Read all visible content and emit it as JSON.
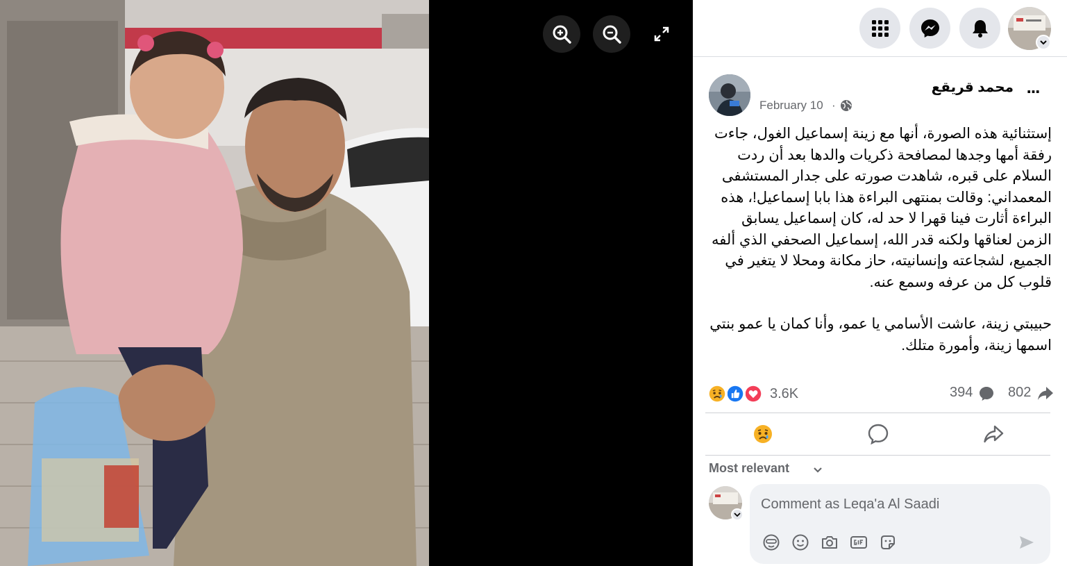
{
  "colors": {
    "accent": "#1877f2",
    "secondary_text": "#65676b",
    "primary_text": "#050505",
    "love": "#f33e58",
    "haha_sad": "#f7b125"
  },
  "viewer": {
    "zoom_in_icon": "magnifier-plus-icon",
    "zoom_out_icon": "magnifier-minus-icon",
    "fullscreen_icon": "expand-arrows-icon",
    "photo_alt": "Man holding a little girl in a pink jacket"
  },
  "topbar": {
    "menu_icon": "grid-menu-icon",
    "messenger_icon": "messenger-icon",
    "notifications_icon": "bell-icon",
    "account_icon": "chevron-down-icon"
  },
  "post": {
    "author": "محمد قريقع",
    "more_label": "...",
    "date": "February 10",
    "dot": "·",
    "privacy_icon": "globe-icon",
    "paragraph_1": "إستثنائية هذه الصورة، أنها مع زينة إسماعيل الغول، جاءت رفقة أمها وجدها لمصافحة ذكريات والدها بعد أن ردت السلام على قبره، شاهدت صورته على جدار المستشفى المعمداني: وقالت بمنتهى البراءة هذا بابا إسماعيل!، هذه البراءة أثارت فينا قهرا لا حد له، كان إسماعيل يسابق الزمن لعناقها ولكنه قدر الله، إسماعيل الصحفي الذي ألفه الجميع، لشجاعته وإنسانيته، حاز مكانة ومحلا لا يتغير في قلوب كل من عرفه وسمع عنه.",
    "paragraph_2": "حبيبتي زينة، عاشت الأسامي يا عمو، وأنا كمان يا عمو بنتي اسمها زينة، وأمورة متلك."
  },
  "stats": {
    "reactions": [
      "sad",
      "like",
      "love"
    ],
    "reaction_count": "3.6K",
    "comment_count": "394",
    "share_count": "802"
  },
  "actions": {
    "react_icon": "sad-face-icon",
    "comment_icon": "comment-bubble-icon",
    "share_icon": "share-arrow-icon"
  },
  "comments": {
    "sort_label": "Most relevant",
    "placeholder": "Comment as Leqa'a Al Saadi",
    "tools": [
      "avatar-sticker-icon",
      "emoji-icon",
      "camera-icon",
      "gif-icon",
      "sticker-icon"
    ]
  }
}
